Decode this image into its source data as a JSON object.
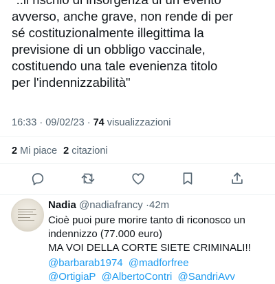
{
  "tweet": {
    "quote_lines": [
      "\"..il rischio di insorgenza di un evento",
      "avverso, anche grave, non rende di per",
      "sé costituzionalmente illegittima la",
      "previsione di un obbligo vaccinale,",
      "costituendo una tale evenienza titolo",
      "per l'indennizzabilità\""
    ],
    "time": "16:33",
    "separator": "·",
    "date": "09/02/23",
    "views_count": "74",
    "views_label": "visualizzazioni"
  },
  "stats": {
    "likes_count": "2",
    "likes_label": "Mi piace",
    "quotes_count": "2",
    "quotes_label": "citazioni"
  },
  "actions": [
    {
      "name": "reply-icon"
    },
    {
      "name": "retweet-icon"
    },
    {
      "name": "like-icon"
    },
    {
      "name": "bookmark-icon"
    },
    {
      "name": "share-icon"
    }
  ],
  "reply": {
    "name": "Nadia",
    "handle": "@nadiafrancy",
    "dot": "·",
    "time": "42m",
    "text_lines": [
      "Cioè puoi pure morire tanto di riconosco un",
      "indennizzo (77.000 euro)",
      "MA VOI DELLA CORTE SIETE CRIMINALI!!"
    ],
    "mention_lines": [
      [
        "@barbarab1974",
        "@madforfree"
      ],
      [
        "@OrtigiaP",
        "@AlbertoContri",
        "@SandriAvv"
      ]
    ]
  },
  "colors": {
    "text": "#0f1419",
    "secondary": "#536471",
    "link": "#1d9bf0",
    "divider": "#eff3f4"
  }
}
